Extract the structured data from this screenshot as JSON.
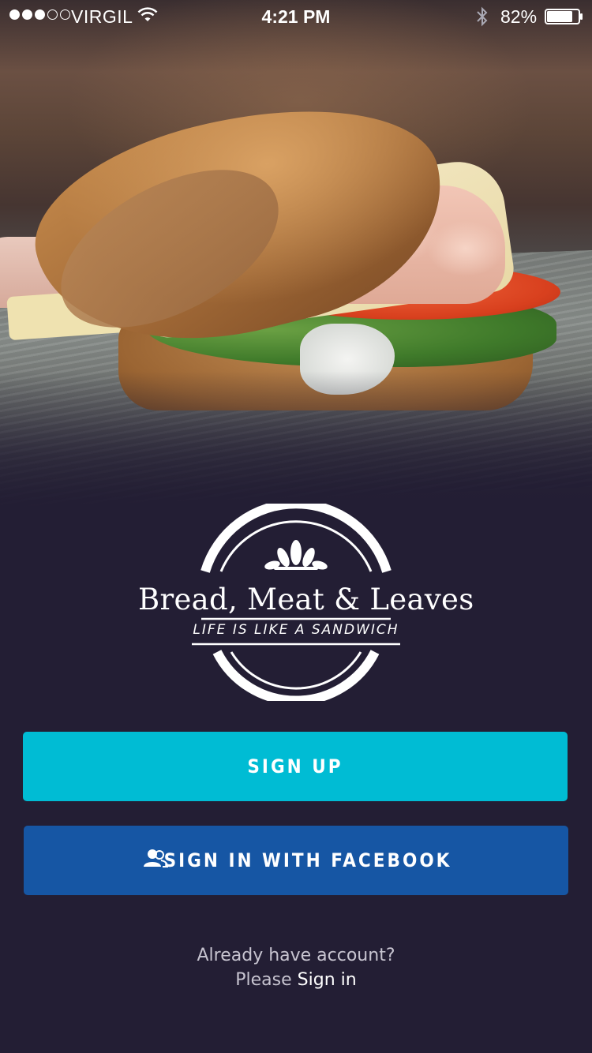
{
  "status_bar": {
    "signal_dots": [
      true,
      true,
      true,
      false,
      false
    ],
    "carrier": "VIRGIL",
    "time": "4:21 PM",
    "battery": "82%",
    "battery_level": 0.82
  },
  "brand": {
    "name": "Bread, Meat & Leaves",
    "tagline": "Life is like a sandwich"
  },
  "actions": {
    "signup_label": "SIGN UP",
    "facebook_label": "SIGN IN WITH FACEBOOK"
  },
  "footer": {
    "line1": "Already have account?",
    "prefix": "Please",
    "signin_label": "Sign in"
  },
  "colors": {
    "background": "#231e34",
    "signup_button": "#00bcd4",
    "facebook_button": "#1656a4"
  },
  "icons": {
    "signal": "signal-dots-icon",
    "wifi": "wifi-icon",
    "bluetooth": "bluetooth-icon",
    "battery": "battery-icon",
    "logo_emblem": "sandwich-logo-emblem",
    "facebook": "user-group-icon"
  }
}
